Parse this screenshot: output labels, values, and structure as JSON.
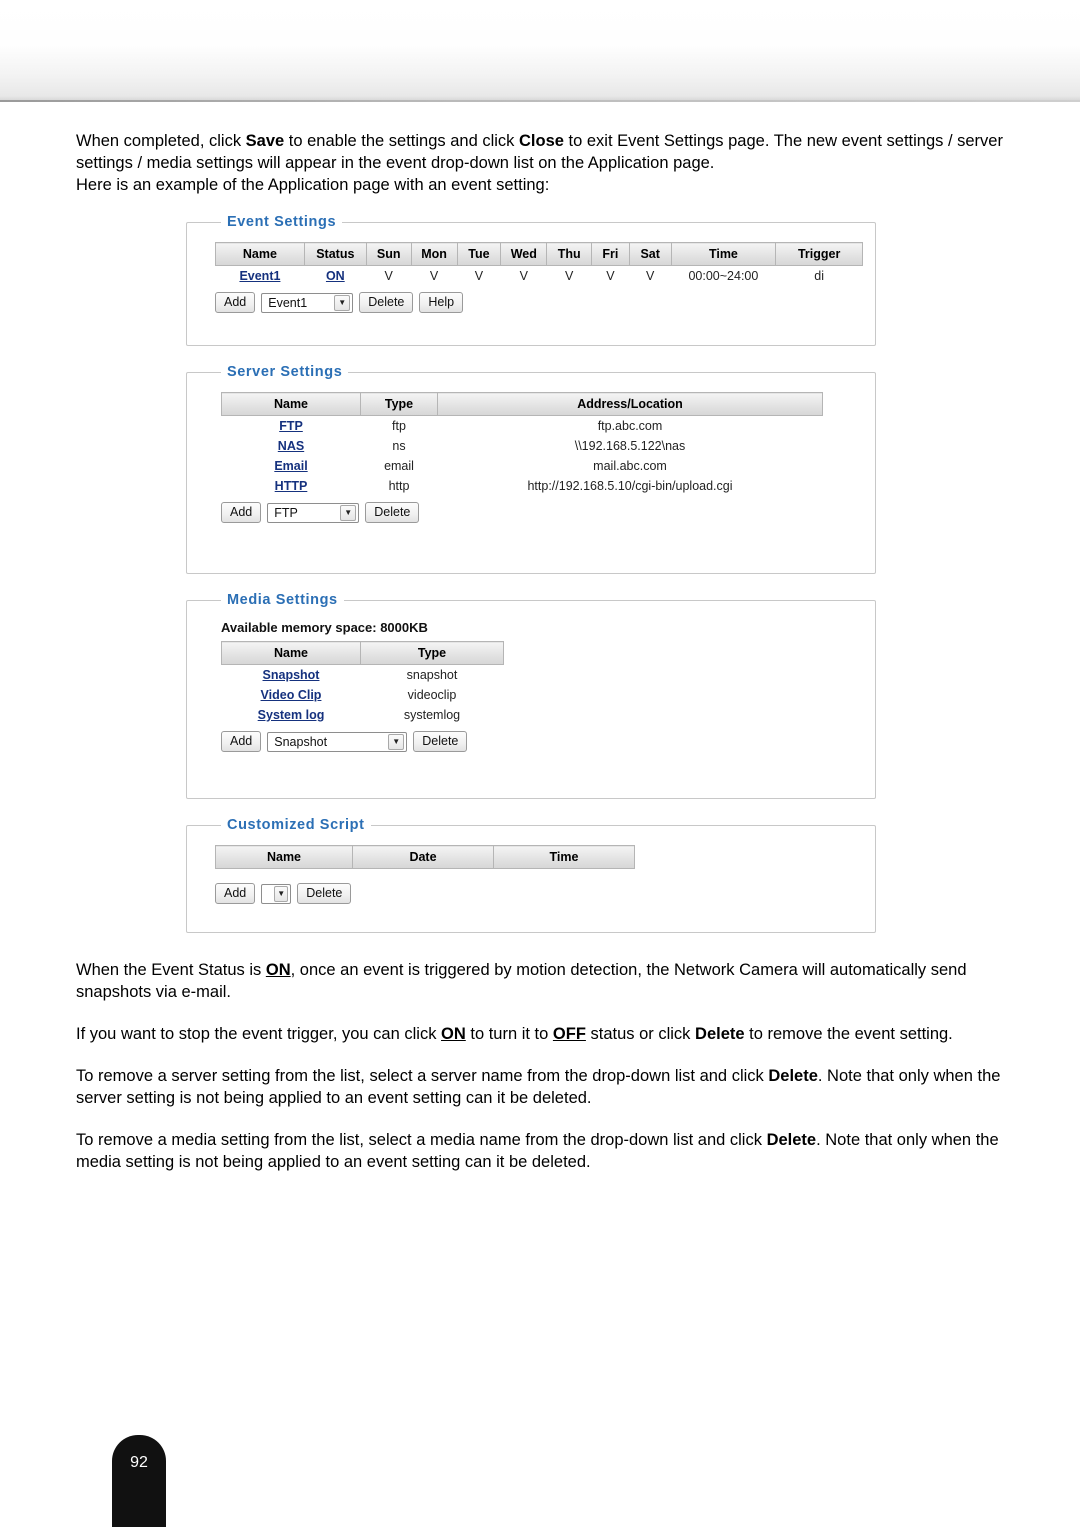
{
  "intro": {
    "p1_a": "When completed, click ",
    "p1_save": "Save",
    "p1_b": " to enable the settings and click ",
    "p1_close": "Close",
    "p1_c": " to exit Event Settings page. The new event settings / server settings / media settings will appear in the event drop-down list on the Application page.",
    "p2": "Here is an example of the Application page with an event setting:"
  },
  "event_settings": {
    "legend": "Event Settings",
    "headers": [
      "Name",
      "Status",
      "Sun",
      "Mon",
      "Tue",
      "Wed",
      "Thu",
      "Fri",
      "Sat",
      "Time",
      "Trigger"
    ],
    "rows": [
      {
        "name": "Event1",
        "status": "ON",
        "sun": "V",
        "mon": "V",
        "tue": "V",
        "wed": "V",
        "thu": "V",
        "fri": "V",
        "sat": "V",
        "time": "00:00~24:00",
        "trigger": "di"
      }
    ],
    "add_label": "Add",
    "select_value": "Event1",
    "delete_label": "Delete",
    "help_label": "Help"
  },
  "server_settings": {
    "legend": "Server Settings",
    "headers": [
      "Name",
      "Type",
      "Address/Location"
    ],
    "rows": [
      {
        "name": "FTP",
        "type": "ftp",
        "address": "ftp.abc.com"
      },
      {
        "name": "NAS",
        "type": "ns",
        "address": "\\\\192.168.5.122\\nas"
      },
      {
        "name": "Email",
        "type": "email",
        "address": "mail.abc.com"
      },
      {
        "name": "HTTP",
        "type": "http",
        "address": "http://192.168.5.10/cgi-bin/upload.cgi"
      }
    ],
    "add_label": "Add",
    "select_value": "FTP",
    "delete_label": "Delete"
  },
  "media_settings": {
    "legend": "Media Settings",
    "memory_line": "Available memory space: 8000KB",
    "headers": [
      "Name",
      "Type"
    ],
    "rows": [
      {
        "name": "Snapshot",
        "type": "snapshot"
      },
      {
        "name": "Video Clip",
        "type": "videoclip"
      },
      {
        "name": "System log",
        "type": "systemlog"
      }
    ],
    "add_label": "Add",
    "select_value": "Snapshot",
    "delete_label": "Delete"
  },
  "customized_script": {
    "legend": "Customized Script",
    "headers": [
      "Name",
      "Date",
      "Time"
    ],
    "rows": [],
    "add_label": "Add",
    "select_value": "",
    "delete_label": "Delete"
  },
  "notes": {
    "n1_a": "When the Event Status is ",
    "n1_on": "ON",
    "n1_b": ", once an event is triggered by motion detection, the Network Camera will automatically send snapshots via e-mail.",
    "n2_a": "If you want to stop the event trigger, you can click ",
    "n2_on": "ON",
    "n2_b": " to turn it to ",
    "n2_off": "OFF",
    "n2_c": " status or click ",
    "n2_delete": "Delete",
    "n2_d": " to remove the event setting.",
    "n3_a": "To remove a server setting from the list, select a server name from the drop-down list and click ",
    "n3_delete": "Delete",
    "n3_b": ". Note that only when the server setting is not being applied to an event setting can it be deleted.",
    "n4_a": "To remove a media setting from the list, select a media name from the drop-down list and click ",
    "n4_delete": "Delete",
    "n4_b": ". Note that only when the media setting is not being applied to an event setting can it be deleted."
  },
  "footer": {
    "page_number": "92"
  },
  "icons": {
    "chevron_down": "▼"
  }
}
